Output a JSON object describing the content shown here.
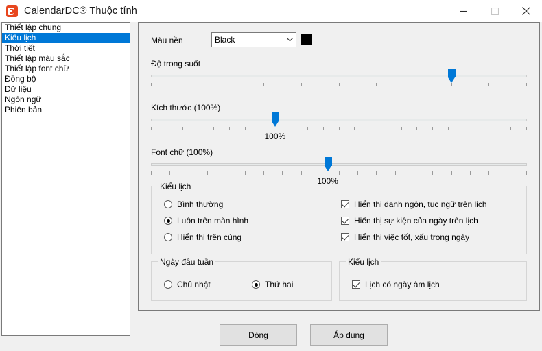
{
  "window": {
    "title": "CalendarDC® Thuộc tính",
    "icon": "app-logo-icon",
    "minimize_label": "",
    "maximize_label": "",
    "close_label": ""
  },
  "sidebar": {
    "items": [
      {
        "label": "Thiết lập chung",
        "selected": false
      },
      {
        "label": "Kiểu lịch",
        "selected": true
      },
      {
        "label": "Thời tiết",
        "selected": false
      },
      {
        "label": "Thiết lập màu sắc",
        "selected": false
      },
      {
        "label": "Thiết lập font chữ",
        "selected": false
      },
      {
        "label": "Đồng bộ",
        "selected": false
      },
      {
        "label": "Dữ liệu",
        "selected": false
      },
      {
        "label": "Ngôn ngữ",
        "selected": false
      },
      {
        "label": "Phiên bản",
        "selected": false
      }
    ]
  },
  "panel": {
    "background_color": {
      "label": "Màu nền",
      "value": "Black",
      "swatch_hex": "#000000"
    },
    "transparency": {
      "label": "Độ trong suốt",
      "percent": 80,
      "ticks": 11,
      "value_text": ""
    },
    "size": {
      "label": "Kích thước (100%)",
      "percent": 33,
      "ticks": 25,
      "value_text": "100%"
    },
    "font": {
      "label": "Font chữ (100%)",
      "percent": 47,
      "ticks": 21,
      "value_text": "100%"
    },
    "calendar_style_group": {
      "title": "Kiểu lịch",
      "radios": [
        {
          "label": "Bình thường",
          "checked": false
        },
        {
          "label": "Luôn trên màn hình",
          "checked": true
        },
        {
          "label": "Hiển thị trên cùng",
          "checked": false
        }
      ],
      "checkboxes": [
        {
          "label": "Hiển thị danh ngôn, tục ngữ trên lịch",
          "checked": true
        },
        {
          "label": "Hiển thị sự kiện của ngày trên lịch",
          "checked": true
        },
        {
          "label": "Hiển thị việc tốt, xấu trong ngày",
          "checked": true
        }
      ]
    },
    "first_day_group": {
      "title": "Ngày đầu tuần",
      "radios": [
        {
          "label": "Chủ nhật",
          "checked": false
        },
        {
          "label": "Thứ hai",
          "checked": true
        }
      ]
    },
    "lunar_group": {
      "title": "Kiểu lịch",
      "checkboxes": [
        {
          "label": "Lịch có ngày âm lịch",
          "checked": true
        }
      ]
    }
  },
  "footer": {
    "close_button": "Đóng",
    "apply_button": "Áp dụng"
  },
  "colors": {
    "accent": "#0078d7",
    "window_bg": "#f0f0f0",
    "list_bg": "#ffffff",
    "border": "#7a7a7a"
  }
}
